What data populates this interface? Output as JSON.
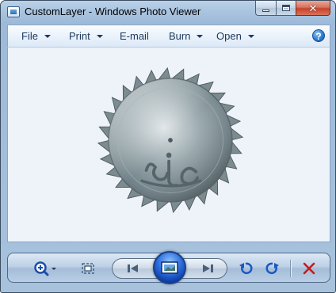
{
  "window": {
    "title": "CustomLayer - Windows Photo Viewer"
  },
  "menu": {
    "items": [
      {
        "label": "File",
        "has_dropdown": true
      },
      {
        "label": "Print",
        "has_dropdown": true
      },
      {
        "label": "E-mail",
        "has_dropdown": false
      },
      {
        "label": "Burn",
        "has_dropdown": true
      },
      {
        "label": "Open",
        "has_dropdown": true
      }
    ],
    "help_label": "?"
  },
  "viewer": {
    "image": "circular-saw-blade-image"
  },
  "toolbar": {
    "buttons": [
      {
        "name": "zoom-button",
        "icon": "magnifier-plus-icon"
      },
      {
        "name": "actual-size-button",
        "icon": "fit-to-window-icon"
      },
      {
        "name": "previous-button",
        "icon": "previous-icon"
      },
      {
        "name": "slideshow-button",
        "icon": "slideshow-icon"
      },
      {
        "name": "next-button",
        "icon": "next-icon"
      },
      {
        "name": "rotate-counterclockwise-button",
        "icon": "rotate-left-icon"
      },
      {
        "name": "rotate-clockwise-button",
        "icon": "rotate-right-icon"
      },
      {
        "name": "delete-button",
        "icon": "delete-icon"
      }
    ]
  },
  "colors": {
    "menu_text": "#1e395b",
    "viewer_background": "#eef3fa",
    "delete_red": "#c21d1d",
    "rotate_blue": "#1a56c4"
  }
}
